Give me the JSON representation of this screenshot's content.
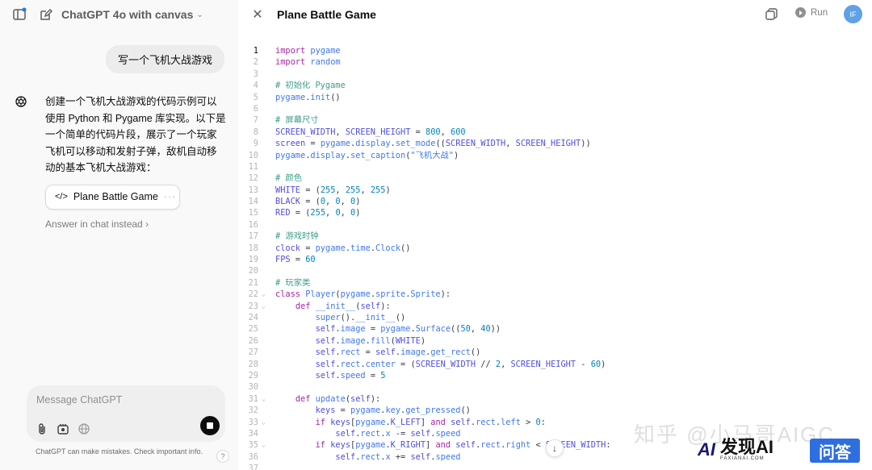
{
  "left": {
    "model_title": "ChatGPT 4o with canvas",
    "user_message": "写一个飞机大战游戏",
    "assistant_text": "创建一个飞机大战游戏的代码示例可以使用 Python 和 Pygame 库实现。以下是一个简单的代码片段，展示了一个玩家飞机可以移动和发射子弹，敌机自动移动的基本飞机大战游戏：",
    "canvas_card_label": "Plane Battle Game",
    "answer_link": "Answer in chat instead",
    "composer_placeholder": "Message ChatGPT",
    "disclaimer": "ChatGPT can make mistakes. Check important info.",
    "help_label": "?"
  },
  "right": {
    "title": "Plane Battle Game",
    "run_label": "Run",
    "avatar_initials": "IF"
  },
  "code_lines": [
    {
      "n": "1",
      "html": "<span class=\"k\">import</span> <span class=\"m\">pygame</span>"
    },
    {
      "n": "2",
      "html": "<span class=\"k\">import</span> <span class=\"m\">random</span>"
    },
    {
      "n": "3",
      "html": ""
    },
    {
      "n": "4",
      "html": "<span class=\"c\"># 初始化 Pygame</span>"
    },
    {
      "n": "5",
      "html": "<span class=\"m\">pygame</span>.<span class=\"m\">init</span>()"
    },
    {
      "n": "6",
      "html": ""
    },
    {
      "n": "7",
      "html": "<span class=\"c\"># 屏幕尺寸</span>"
    },
    {
      "n": "8",
      "html": "<span class=\"n\">SCREEN_WIDTH</span>, <span class=\"n\">SCREEN_HEIGHT</span> = <span class=\"num\">800</span>, <span class=\"num\">600</span>"
    },
    {
      "n": "9",
      "html": "<span class=\"n\">screen</span> = <span class=\"m\">pygame</span>.<span class=\"m\">display</span>.<span class=\"m\">set_mode</span>((<span class=\"n\">SCREEN_WIDTH</span>, <span class=\"n\">SCREEN_HEIGHT</span>))"
    },
    {
      "n": "10",
      "html": "<span class=\"m\">pygame</span>.<span class=\"m\">display</span>.<span class=\"m\">set_caption</span>(<span class=\"s\">\"飞机大战\"</span>)"
    },
    {
      "n": "11",
      "html": ""
    },
    {
      "n": "12",
      "html": "<span class=\"c\"># 颜色</span>"
    },
    {
      "n": "13",
      "html": "<span class=\"n\">WHITE</span> = (<span class=\"num\">255</span>, <span class=\"num\">255</span>, <span class=\"num\">255</span>)"
    },
    {
      "n": "14",
      "html": "<span class=\"n\">BLACK</span> = (<span class=\"num\">0</span>, <span class=\"num\">0</span>, <span class=\"num\">0</span>)"
    },
    {
      "n": "15",
      "html": "<span class=\"n\">RED</span> = (<span class=\"num\">255</span>, <span class=\"num\">0</span>, <span class=\"num\">0</span>)"
    },
    {
      "n": "16",
      "html": ""
    },
    {
      "n": "17",
      "html": "<span class=\"c\"># 游戏时钟</span>"
    },
    {
      "n": "18",
      "html": "<span class=\"n\">clock</span> = <span class=\"m\">pygame</span>.<span class=\"m\">time</span>.<span class=\"m\">Clock</span>()"
    },
    {
      "n": "19",
      "html": "<span class=\"n\">FPS</span> = <span class=\"num\">60</span>"
    },
    {
      "n": "20",
      "html": ""
    },
    {
      "n": "21",
      "html": "<span class=\"c\"># 玩家类</span>"
    },
    {
      "n": "22",
      "fold": true,
      "html": "<span class=\"k\">class</span> <span class=\"m\">Player</span>(<span class=\"m\">pygame</span>.<span class=\"m\">sprite</span>.<span class=\"m\">Sprite</span>):"
    },
    {
      "n": "23",
      "fold": true,
      "html": "    <span class=\"k\">def</span> <span class=\"m\">__init__</span>(<span class=\"n\">self</span>):"
    },
    {
      "n": "24",
      "html": "        <span class=\"m\">super</span>().<span class=\"m\">__init__</span>()"
    },
    {
      "n": "25",
      "html": "        <span class=\"n\">self</span>.<span class=\"m\">image</span> = <span class=\"m\">pygame</span>.<span class=\"m\">Surface</span>((<span class=\"num\">50</span>, <span class=\"num\">40</span>))"
    },
    {
      "n": "26",
      "html": "        <span class=\"n\">self</span>.<span class=\"m\">image</span>.<span class=\"m\">fill</span>(<span class=\"n\">WHITE</span>)"
    },
    {
      "n": "27",
      "html": "        <span class=\"n\">self</span>.<span class=\"m\">rect</span> = <span class=\"n\">self</span>.<span class=\"m\">image</span>.<span class=\"m\">get_rect</span>()"
    },
    {
      "n": "28",
      "html": "        <span class=\"n\">self</span>.<span class=\"m\">rect</span>.<span class=\"m\">center</span> = (<span class=\"n\">SCREEN_WIDTH</span> // <span class=\"num\">2</span>, <span class=\"n\">SCREEN_HEIGHT</span> - <span class=\"num\">60</span>)"
    },
    {
      "n": "29",
      "html": "        <span class=\"n\">self</span>.<span class=\"m\">speed</span> = <span class=\"num\">5</span>"
    },
    {
      "n": "30",
      "html": ""
    },
    {
      "n": "31",
      "fold": true,
      "html": "    <span class=\"k\">def</span> <span class=\"m\">update</span>(<span class=\"n\">self</span>):"
    },
    {
      "n": "32",
      "html": "        <span class=\"n\">keys</span> = <span class=\"m\">pygame</span>.<span class=\"m\">key</span>.<span class=\"m\">get_pressed</span>()"
    },
    {
      "n": "33",
      "fold": true,
      "html": "        <span class=\"k\">if</span> <span class=\"n\">keys</span>[<span class=\"m\">pygame</span>.<span class=\"n\">K_LEFT</span>] <span class=\"k\">and</span> <span class=\"n\">self</span>.<span class=\"m\">rect</span>.<span class=\"m\">left</span> > <span class=\"num\">0</span>:"
    },
    {
      "n": "34",
      "html": "            <span class=\"n\">self</span>.<span class=\"m\">rect</span>.<span class=\"m\">x</span> -= <span class=\"n\">self</span>.<span class=\"m\">speed</span>"
    },
    {
      "n": "35",
      "fold": true,
      "html": "        <span class=\"k\">if</span> <span class=\"n\">keys</span>[<span class=\"m\">pygame</span>.<span class=\"n\">K_RIGHT</span>] <span class=\"k\">and</span> <span class=\"n\">self</span>.<span class=\"m\">rect</span>.<span class=\"m\">right</span> < <span class=\"n\">SCREEN_WIDTH</span>:"
    },
    {
      "n": "36",
      "html": "            <span class=\"n\">self</span>.<span class=\"m\">rect</span>.<span class=\"m\">x</span> += <span class=\"n\">self</span>.<span class=\"m\">speed</span>"
    },
    {
      "n": "37",
      "html": ""
    }
  ],
  "watermark": {
    "zhihu": "知乎 @小马哥AIGC",
    "brand_ai": "AI",
    "brand_cn": "发现AI",
    "brand_en": "FAXIANAI.COM",
    "qa": "问答"
  }
}
